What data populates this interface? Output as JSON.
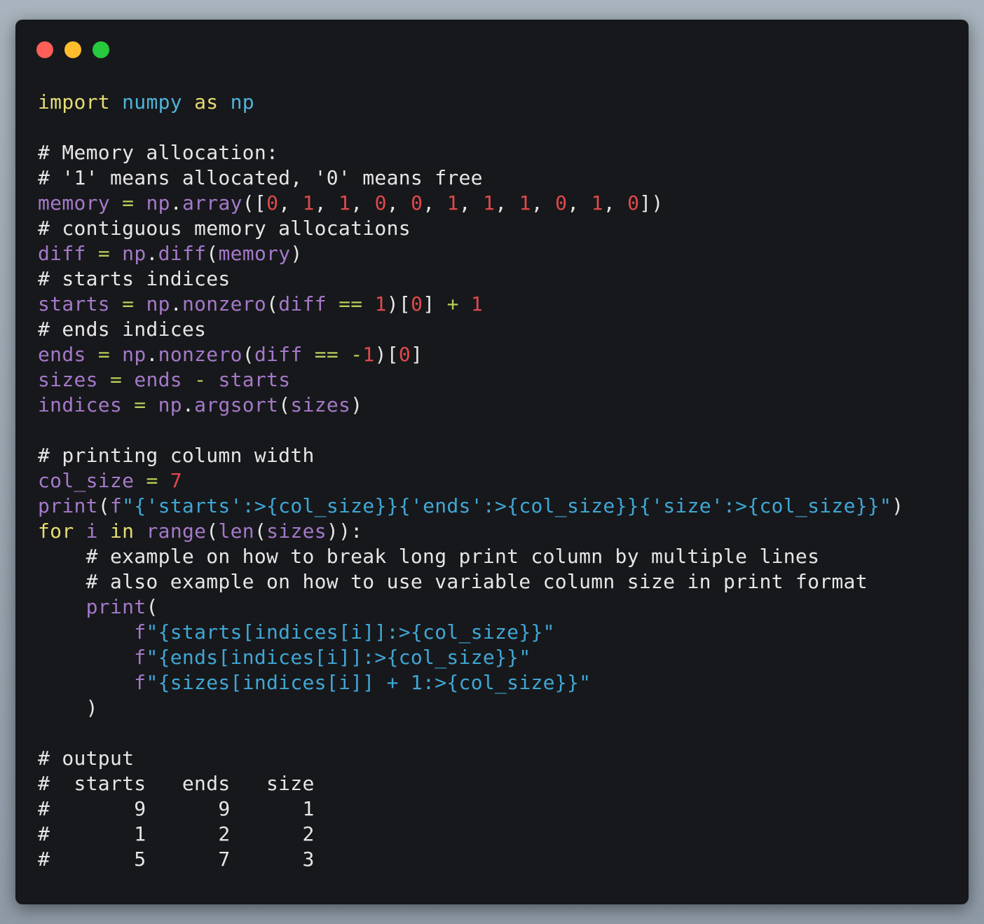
{
  "window": {
    "controls": [
      "close",
      "minimize",
      "maximize"
    ]
  },
  "colors": {
    "background": "#17181b",
    "keyword": "#e6db74",
    "module": "#4fb3d9",
    "variable": "#a479c9",
    "number": "#e0494b",
    "string": "#3fa7d6",
    "comment": "#e6e6e6",
    "operator": "#b6cf5a"
  },
  "code": [
    [
      [
        "kw",
        "import"
      ],
      [
        "pl",
        " "
      ],
      [
        "mod",
        "numpy"
      ],
      [
        "pl",
        " "
      ],
      [
        "kw",
        "as"
      ],
      [
        "pl",
        " "
      ],
      [
        "mod",
        "np"
      ]
    ],
    [],
    [
      [
        "com",
        "# Memory allocation:"
      ]
    ],
    [
      [
        "com",
        "# '1' means allocated, '0' means free"
      ]
    ],
    [
      [
        "var",
        "memory"
      ],
      [
        "pl",
        " "
      ],
      [
        "op",
        "="
      ],
      [
        "pl",
        " "
      ],
      [
        "var",
        "np"
      ],
      [
        "pl",
        "."
      ],
      [
        "var",
        "array"
      ],
      [
        "pl",
        "(["
      ],
      [
        "num",
        "0"
      ],
      [
        "pl",
        ", "
      ],
      [
        "num",
        "1"
      ],
      [
        "pl",
        ", "
      ],
      [
        "num",
        "1"
      ],
      [
        "pl",
        ", "
      ],
      [
        "num",
        "0"
      ],
      [
        "pl",
        ", "
      ],
      [
        "num",
        "0"
      ],
      [
        "pl",
        ", "
      ],
      [
        "num",
        "1"
      ],
      [
        "pl",
        ", "
      ],
      [
        "num",
        "1"
      ],
      [
        "pl",
        ", "
      ],
      [
        "num",
        "1"
      ],
      [
        "pl",
        ", "
      ],
      [
        "num",
        "0"
      ],
      [
        "pl",
        ", "
      ],
      [
        "num",
        "1"
      ],
      [
        "pl",
        ", "
      ],
      [
        "num",
        "0"
      ],
      [
        "pl",
        "])"
      ]
    ],
    [
      [
        "com",
        "# contiguous memory allocations"
      ]
    ],
    [
      [
        "var",
        "diff"
      ],
      [
        "pl",
        " "
      ],
      [
        "op",
        "="
      ],
      [
        "pl",
        " "
      ],
      [
        "var",
        "np"
      ],
      [
        "pl",
        "."
      ],
      [
        "var",
        "diff"
      ],
      [
        "pl",
        "("
      ],
      [
        "var",
        "memory"
      ],
      [
        "pl",
        ")"
      ]
    ],
    [
      [
        "com",
        "# starts indices"
      ]
    ],
    [
      [
        "var",
        "starts"
      ],
      [
        "pl",
        " "
      ],
      [
        "op",
        "="
      ],
      [
        "pl",
        " "
      ],
      [
        "var",
        "np"
      ],
      [
        "pl",
        "."
      ],
      [
        "var",
        "nonzero"
      ],
      [
        "pl",
        "("
      ],
      [
        "var",
        "diff"
      ],
      [
        "pl",
        " "
      ],
      [
        "op",
        "=="
      ],
      [
        "pl",
        " "
      ],
      [
        "num",
        "1"
      ],
      [
        "pl",
        ")["
      ],
      [
        "num",
        "0"
      ],
      [
        "pl",
        "] "
      ],
      [
        "op",
        "+"
      ],
      [
        "pl",
        " "
      ],
      [
        "num",
        "1"
      ]
    ],
    [
      [
        "com",
        "# ends indices"
      ]
    ],
    [
      [
        "var",
        "ends"
      ],
      [
        "pl",
        " "
      ],
      [
        "op",
        "="
      ],
      [
        "pl",
        " "
      ],
      [
        "var",
        "np"
      ],
      [
        "pl",
        "."
      ],
      [
        "var",
        "nonzero"
      ],
      [
        "pl",
        "("
      ],
      [
        "var",
        "diff"
      ],
      [
        "pl",
        " "
      ],
      [
        "op",
        "=="
      ],
      [
        "pl",
        " "
      ],
      [
        "op",
        "-"
      ],
      [
        "num",
        "1"
      ],
      [
        "pl",
        ")["
      ],
      [
        "num",
        "0"
      ],
      [
        "pl",
        "]"
      ]
    ],
    [
      [
        "var",
        "sizes"
      ],
      [
        "pl",
        " "
      ],
      [
        "op",
        "="
      ],
      [
        "pl",
        " "
      ],
      [
        "var",
        "ends"
      ],
      [
        "pl",
        " "
      ],
      [
        "op",
        "-"
      ],
      [
        "pl",
        " "
      ],
      [
        "var",
        "starts"
      ]
    ],
    [
      [
        "var",
        "indices"
      ],
      [
        "pl",
        " "
      ],
      [
        "op",
        "="
      ],
      [
        "pl",
        " "
      ],
      [
        "var",
        "np"
      ],
      [
        "pl",
        "."
      ],
      [
        "var",
        "argsort"
      ],
      [
        "pl",
        "("
      ],
      [
        "var",
        "sizes"
      ],
      [
        "pl",
        ")"
      ]
    ],
    [],
    [
      [
        "com",
        "# printing column width"
      ]
    ],
    [
      [
        "var",
        "col_size"
      ],
      [
        "pl",
        " "
      ],
      [
        "op",
        "="
      ],
      [
        "pl",
        " "
      ],
      [
        "num",
        "7"
      ]
    ],
    [
      [
        "var",
        "print"
      ],
      [
        "pl",
        "("
      ],
      [
        "var",
        "f"
      ],
      [
        "str",
        "\"{'starts':>{col_size}}{'ends':>{col_size}}{'size':>{col_size}}\""
      ],
      [
        "pl",
        ")"
      ]
    ],
    [
      [
        "kw",
        "for"
      ],
      [
        "pl",
        " "
      ],
      [
        "var",
        "i"
      ],
      [
        "pl",
        " "
      ],
      [
        "kw",
        "in"
      ],
      [
        "pl",
        " "
      ],
      [
        "var",
        "range"
      ],
      [
        "pl",
        "("
      ],
      [
        "var",
        "len"
      ],
      [
        "pl",
        "("
      ],
      [
        "var",
        "sizes"
      ],
      [
        "pl",
        "))"
      ],
      [
        "pl",
        ":"
      ]
    ],
    [
      [
        "com",
        "    # example on how to break long print column by multiple lines"
      ]
    ],
    [
      [
        "com",
        "    # also example on how to use variable column size in print format"
      ]
    ],
    [
      [
        "pl",
        "    "
      ],
      [
        "var",
        "print"
      ],
      [
        "pl",
        "("
      ]
    ],
    [
      [
        "pl",
        "        "
      ],
      [
        "var",
        "f"
      ],
      [
        "str",
        "\"{starts[indices[i]]:>{col_size}}\""
      ]
    ],
    [
      [
        "pl",
        "        "
      ],
      [
        "var",
        "f"
      ],
      [
        "str",
        "\"{ends[indices[i]]:>{col_size}}\""
      ]
    ],
    [
      [
        "pl",
        "        "
      ],
      [
        "var",
        "f"
      ],
      [
        "str",
        "\"{sizes[indices[i]] + 1:>{col_size}}\""
      ]
    ],
    [
      [
        "pl",
        "    )"
      ]
    ],
    [],
    [
      [
        "com",
        "# output"
      ]
    ],
    [
      [
        "com",
        "#  starts   ends   size"
      ]
    ],
    [
      [
        "com",
        "#       9      9      1"
      ]
    ],
    [
      [
        "com",
        "#       1      2      2"
      ]
    ],
    [
      [
        "com",
        "#       5      7      3"
      ]
    ]
  ]
}
